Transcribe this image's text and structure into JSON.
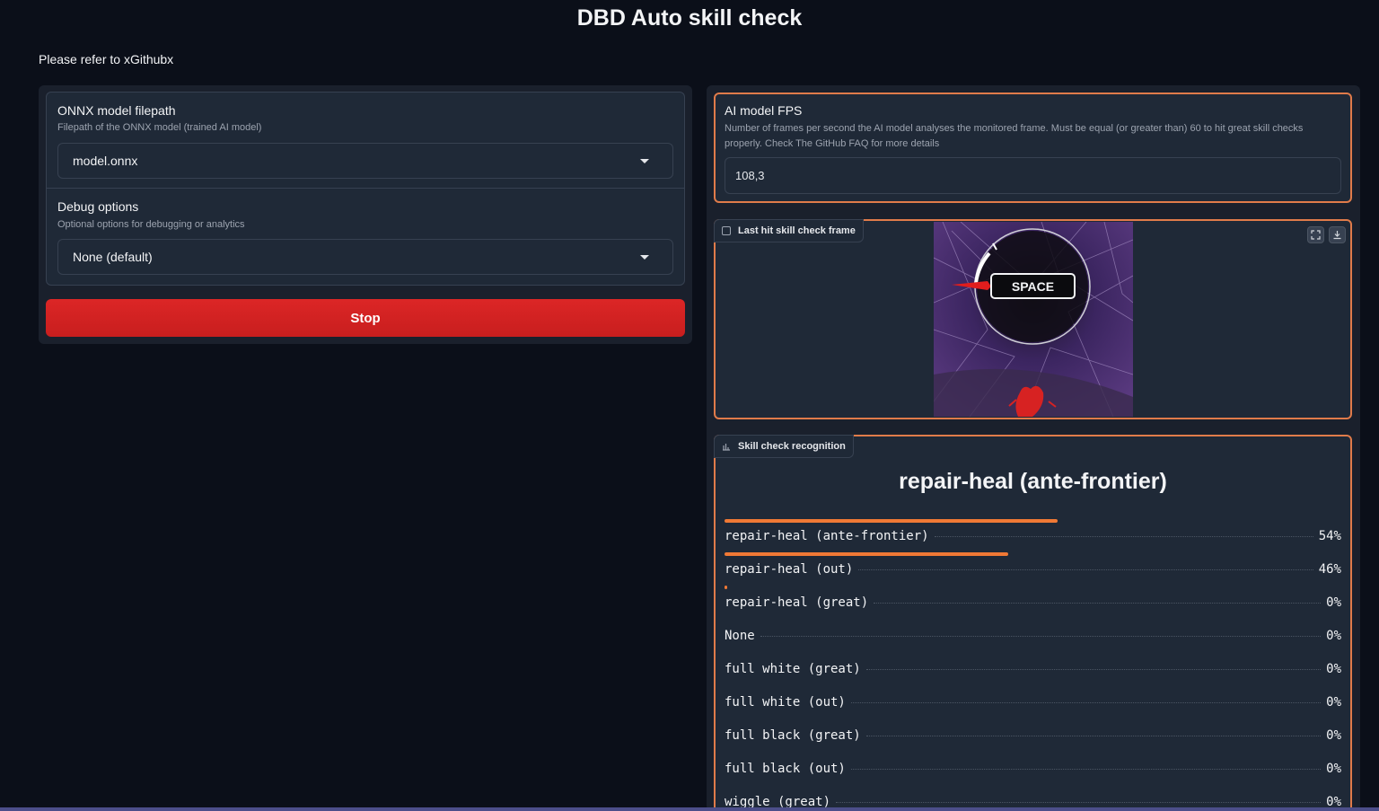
{
  "header": {
    "title": "DBD Auto skill check",
    "subtitle": "Please refer to xGithubx"
  },
  "model": {
    "label": "ONNX model filepath",
    "info": "Filepath of the ONNX model (trained AI model)",
    "value": "model.onnx"
  },
  "debug": {
    "label": "Debug options",
    "info": "Optional options for debugging or analytics",
    "value": "None (default)"
  },
  "stop_button": "Stop",
  "fps": {
    "label": "AI model FPS",
    "info": "Number of frames per second the AI model analyses the monitored frame. Must be equal (or greater than) 60 to hit great skill checks properly. Check The GitHub FAQ for more details",
    "value": "108,3"
  },
  "frame_panel": {
    "label": "Last hit skill check frame",
    "space_text": "SPACE"
  },
  "recognition": {
    "label": "Skill check recognition",
    "title": "repair-heal (ante-frontier)",
    "items": [
      {
        "label": "repair-heal (ante-frontier)",
        "pct_text": "54%",
        "value": 0.54
      },
      {
        "label": "repair-heal (out)",
        "pct_text": "46%",
        "value": 0.46
      },
      {
        "label": "repair-heal (great)",
        "pct_text": "0%",
        "value": 0.004
      },
      {
        "label": "None",
        "pct_text": "0%",
        "value": 0
      },
      {
        "label": "full white (great)",
        "pct_text": "0%",
        "value": 0
      },
      {
        "label": "full white (out)",
        "pct_text": "0%",
        "value": 0
      },
      {
        "label": "full black (great)",
        "pct_text": "0%",
        "value": 0
      },
      {
        "label": "full black (out)",
        "pct_text": "0%",
        "value": 0
      },
      {
        "label": "wiggle (great)",
        "pct_text": "0%",
        "value": 0
      }
    ]
  },
  "colors": {
    "accent": "#e07b4a",
    "stop": "#dc2626",
    "bar": "#f07935"
  },
  "icons": {
    "dropdown": "chevron-down-icon",
    "image": "image-icon",
    "chart": "bar-chart-icon",
    "fullscreen": "fullscreen-icon",
    "download": "download-icon"
  }
}
